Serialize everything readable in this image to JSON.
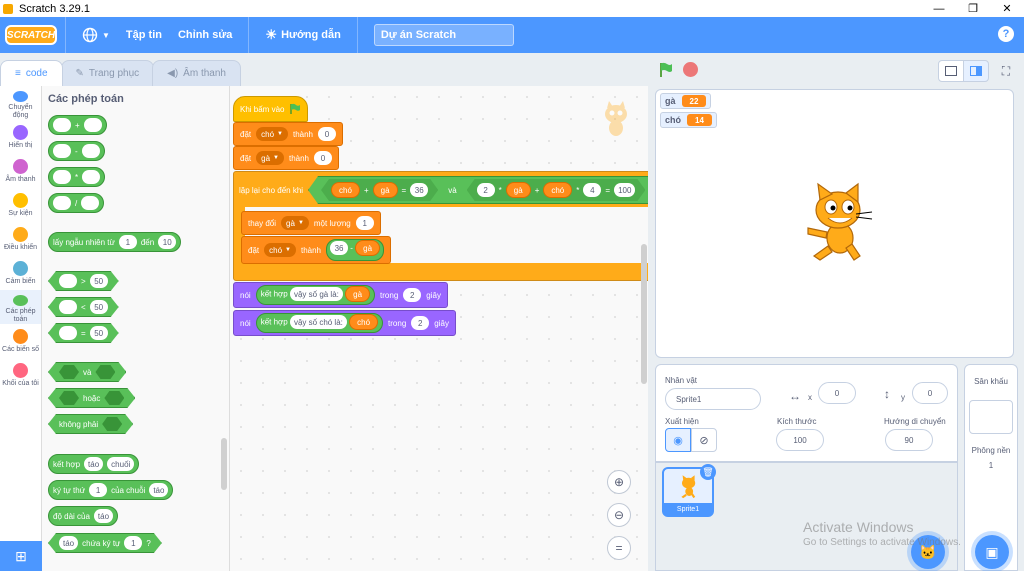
{
  "window": {
    "title": "Scratch 3.29.1",
    "minimize": "—",
    "maximize": "❐",
    "close": "✕"
  },
  "menubar": {
    "logo": "SCRATCH",
    "file": "Tập tin",
    "edit": "Chỉnh sửa",
    "tutorials": "Hướng dẫn",
    "project_title": "Dự án Scratch",
    "help": "?"
  },
  "tabs": {
    "code": "code",
    "costumes": "Trang phục",
    "sounds": "Âm thanh"
  },
  "categories": [
    {
      "label": "Chuyển động",
      "color": "#4c97ff"
    },
    {
      "label": "Hiển thị",
      "color": "#9966ff"
    },
    {
      "label": "Âm thanh",
      "color": "#cf63cf"
    },
    {
      "label": "Sự kiện",
      "color": "#ffbf00"
    },
    {
      "label": "Điều khiển",
      "color": "#ffab19"
    },
    {
      "label": "Cảm biến",
      "color": "#5cb1d6"
    },
    {
      "label": "Các phép toán",
      "color": "#59c059"
    },
    {
      "label": "Các biến số",
      "color": "#ff8c1a"
    },
    {
      "label": "Khối của tôi",
      "color": "#ff6680"
    }
  ],
  "palette": {
    "title": "Các phép toán",
    "ops": [
      "+",
      "-",
      "*",
      "/"
    ],
    "random": {
      "pre": "lấy ngẫu nhiên từ",
      "a": "1",
      "mid": "đến",
      "b": "10"
    },
    "compare": [
      {
        "op": ">",
        "val": "50"
      },
      {
        "op": "<",
        "val": "50"
      },
      {
        "op": "=",
        "val": "50"
      }
    ],
    "and": "và",
    "or": "hoặc",
    "not": "không phải",
    "join": {
      "label": "kết hợp",
      "a": "táo",
      "b": "chuối"
    },
    "letter": {
      "label": "ký tự thứ",
      "n": "1",
      "mid": "của chuỗi",
      "s": "táo"
    },
    "length": {
      "label": "độ dài của",
      "s": "táo"
    },
    "contains": {
      "s": "táo",
      "label": "chứa ký tự",
      "n": "1",
      "q": "?"
    }
  },
  "script": {
    "hat": "Khi bấm vào",
    "set1": {
      "label": "đặt",
      "var": "chó",
      "to": "thành",
      "val": "0"
    },
    "set2": {
      "label": "đặt",
      "var": "gà",
      "to": "thành",
      "val": "0"
    },
    "repeat": {
      "label": "lặp lại cho đến khi",
      "left": {
        "a": "chó",
        "plus": "+",
        "b": "gà",
        "eq": "=",
        "val": "36"
      },
      "and": "và",
      "right": {
        "n2": "2",
        "times": "*",
        "ga": "gà",
        "plus": "+",
        "cho": "chó",
        "times2": "*",
        "n4": "4",
        "eq": "=",
        "val": "100"
      }
    },
    "change": {
      "label": "thay đổi",
      "var": "gà",
      "by": "một lượng",
      "val": "1"
    },
    "set3": {
      "label": "đặt",
      "var": "chó",
      "to": "thành",
      "n": "36",
      "minus": "-",
      "ga": "gà"
    },
    "say1": {
      "label": "nói",
      "join": "kết hợp",
      "text": "vậy số gà là:",
      "var": "gà",
      "for": "trong",
      "secs": "2",
      "unit": "giây"
    },
    "say2": {
      "label": "nói",
      "join": "kết hợp",
      "text": "vậy số chó là:",
      "var": "chó",
      "for": "trong",
      "secs": "2",
      "unit": "giây"
    }
  },
  "monitors": [
    {
      "name": "gà",
      "value": "22"
    },
    {
      "name": "chó",
      "value": "14"
    }
  ],
  "sprite_info": {
    "sprite_label": "Nhân vật",
    "sprite_name": "Sprite1",
    "x_label": "x",
    "x": "0",
    "y_label": "y",
    "y": "0",
    "show_label": "Xuất hiện",
    "size_label": "Kích thước",
    "size": "100",
    "direction_label": "Hướng di chuyển",
    "direction": "90"
  },
  "sprite_list": [
    {
      "name": "Sprite1"
    }
  ],
  "stage_pane": {
    "title": "Sân khấu",
    "backdrops_label": "Phông nền",
    "backdrops": "1"
  },
  "watermark": {
    "line1": "Activate Windows",
    "line2": "Go to Settings to activate Windows."
  },
  "colors": {
    "motion": "#4c97ff",
    "operators": "#59c059",
    "variables": "#ff8c1a",
    "control": "#ffab19",
    "events": "#ffbf00",
    "looks": "#9966ff"
  }
}
